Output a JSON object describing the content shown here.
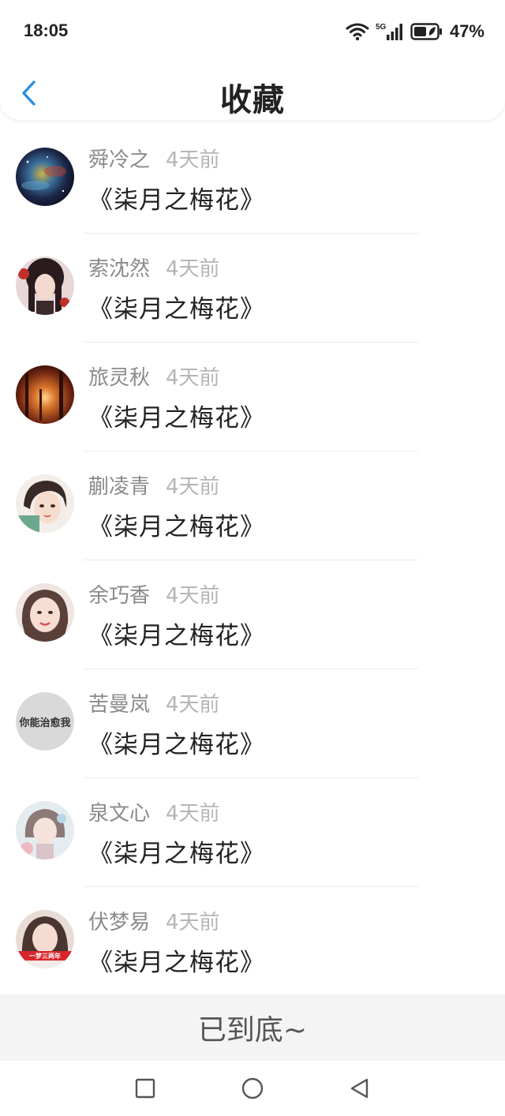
{
  "status_bar": {
    "time": "18:05",
    "network": "5G",
    "battery": "47%"
  },
  "header": {
    "back_icon": "chevron-left-icon",
    "title": "收藏"
  },
  "favorites": [
    {
      "user": "舜冷之",
      "time": "4天前",
      "book": "《柒月之梅花》",
      "avatar": "galaxy"
    },
    {
      "user": "索沈然",
      "time": "4天前",
      "book": "《柒月之梅花》",
      "avatar": "anime-girl-dark"
    },
    {
      "user": "旅灵秋",
      "time": "4天前",
      "book": "《柒月之梅花》",
      "avatar": "autumn-forest"
    },
    {
      "user": "蒯凌青",
      "time": "4天前",
      "book": "《柒月之梅花》",
      "avatar": "illustrated-girl"
    },
    {
      "user": "余巧香",
      "time": "4天前",
      "book": "《柒月之梅花》",
      "avatar": "girl-photo"
    },
    {
      "user": "苦曼岚",
      "time": "4天前",
      "book": "《柒月之梅花》",
      "avatar": "text",
      "avatar_text": "你能治愈我"
    },
    {
      "user": "泉文心",
      "time": "4天前",
      "book": "《柒月之梅花》",
      "avatar": "pastel-girl"
    },
    {
      "user": "伏梦易",
      "time": "4天前",
      "book": "《柒月之梅花》",
      "avatar": "girl-banner",
      "avatar_text": "一梦三两年"
    }
  ],
  "footer": {
    "end_text": "已到底~"
  },
  "nav_bar": {
    "recent_icon": "square-icon",
    "home_icon": "circle-icon",
    "back_icon": "triangle-back-icon"
  },
  "colors": {
    "accent": "#2b8fe0",
    "footer_bg": "#f4f4f4"
  }
}
